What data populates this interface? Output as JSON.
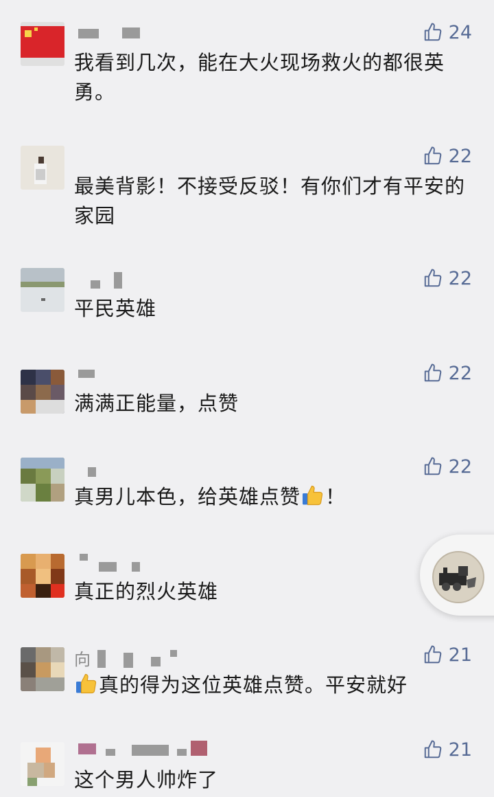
{
  "comments": [
    {
      "likes": "24",
      "text": "我看到几次，能在大火现场救火的都很英勇。"
    },
    {
      "likes": "22",
      "text": "最美背影！不接受反驳！有你们才有平安的家园"
    },
    {
      "likes": "22",
      "text": "平民英雄"
    },
    {
      "likes": "22",
      "text": "满满正能量，点赞"
    },
    {
      "likes": "22",
      "text_before": "真男儿本色，给英雄点赞",
      "text_after": "！"
    },
    {
      "likes": "",
      "text": "真正的烈火英雄"
    },
    {
      "likes": "21",
      "name_visible": "向",
      "text": "真的得为这位英雄点赞。平安就好"
    },
    {
      "likes": "21",
      "text": "这个男人帅炸了"
    }
  ],
  "icons": {
    "like": "thumbs-up-outline-icon",
    "emoji": "thumbs-up-emoji-icon",
    "float": "floating-player-icon"
  },
  "colors": {
    "like": "#576b95",
    "background": "#f0f0f2"
  }
}
